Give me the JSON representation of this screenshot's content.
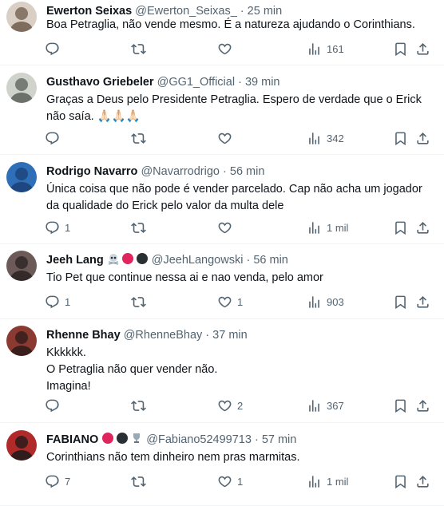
{
  "tweets": [
    {
      "name": "Ewerton Seixas",
      "badges": [],
      "handle": "@Ewerton_Seixas_",
      "time": "25 min",
      "lines": [
        "Boa Petraglia, não vende mesmo. É a natureza ajudando o Corinthians."
      ],
      "replies": "",
      "likes": "",
      "views": "161",
      "avatar_colors": [
        "#d9cfc4",
        "#6d5a4a"
      ]
    },
    {
      "name": "Gusthavo Griebeler",
      "badges": [],
      "handle": "@GG1_Official",
      "time": "39 min",
      "lines": [
        "Graças a Deus pelo Presidente Petraglia. Espero de verdade que o Erick",
        "não saía. 🙏🏻🙏🏻🙏🏻"
      ],
      "replies": "",
      "likes": "",
      "views": "342",
      "avatar_colors": [
        "#cfd3cc",
        "#5a5f58"
      ]
    },
    {
      "name": "Rodrigo Navarro",
      "badges": [],
      "handle": "@Navarrodrigo",
      "time": "56 min",
      "lines": [
        "Única coisa que não pode é vender parcelado. Cap não acha um jogador",
        "da qualidade do Erick pelo valor da multa dele"
      ],
      "replies": "1",
      "likes": "",
      "views": "1 mil",
      "avatar_colors": [
        "#2e6fb8",
        "#1b3f75"
      ]
    },
    {
      "name": "Jeeh Lang",
      "badges": [
        "skull",
        "red",
        "black"
      ],
      "handle": "@JeehLangowski",
      "time": "56 min",
      "lines": [
        "Tio Pet que continue nessa ai e nao venda, pelo amor"
      ],
      "replies": "1",
      "likes": "1",
      "views": "903",
      "avatar_colors": [
        "#6b5a58",
        "#2a2222"
      ]
    },
    {
      "name": "Rhenne Bhay",
      "badges": [],
      "handle": "@RhenneBhay",
      "time": "37 min",
      "lines": [
        "Kkkkkk.",
        "O Petraglia não quer vender não.",
        "Imagina!"
      ],
      "replies": "",
      "likes": "2",
      "views": "367",
      "avatar_colors": [
        "#8a3a30",
        "#2a1a18"
      ]
    },
    {
      "name": "FABIANO",
      "badges": [
        "red",
        "black",
        "trophy"
      ],
      "handle": "@Fabiano52499713",
      "time": "57 min",
      "lines": [
        "Corinthians não tem dinheiro nem pras marmitas."
      ],
      "replies": "7",
      "likes": "1",
      "views": "1 mil",
      "avatar_colors": [
        "#b02a2a",
        "#1a1a1a"
      ]
    }
  ],
  "icons": {
    "reply": "reply-icon",
    "retweet": "retweet-icon",
    "like": "heart-icon",
    "views": "views-icon",
    "bookmark": "bookmark-icon",
    "share": "share-icon"
  },
  "colors": {
    "text": "#0f1419",
    "muted": "#536471",
    "divider": "#eff3f4",
    "red_badge": "#e0245e"
  }
}
